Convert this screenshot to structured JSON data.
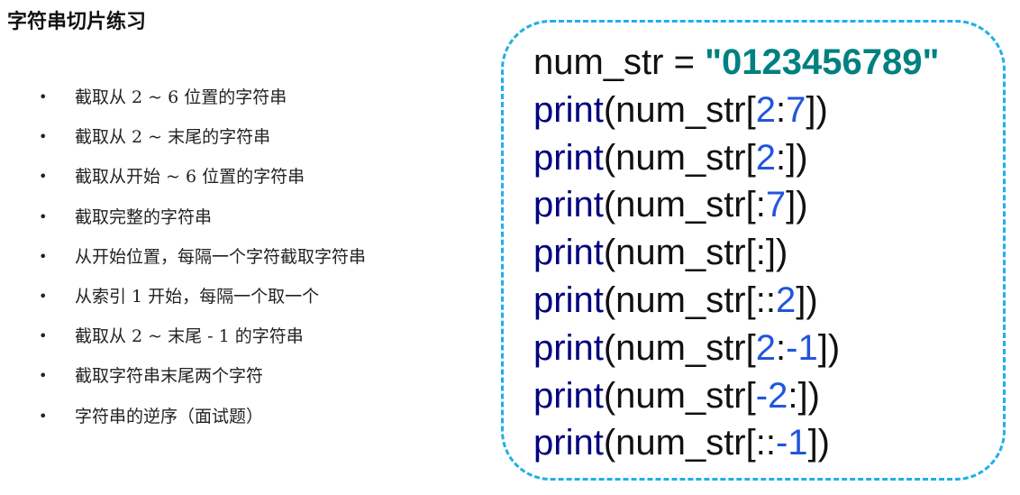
{
  "title": "字符串切片练习",
  "tasks": [
    "截取从 2 ~ 6 位置的字符串",
    "截取从 2 ~ 末尾的字符串",
    "截取从开始 ~ 6 位置的字符串",
    "截取完整的字符串",
    "从开始位置，每隔一个字符截取字符串",
    "从索引 1 开始，每隔一个取一个",
    "截取从 2 ~ 末尾 - 1 的字符串",
    "截取字符串末尾两个字符",
    "字符串的逆序（面试题）"
  ],
  "code": {
    "assign": {
      "var": "num_str = ",
      "value": "\"0123456789\""
    },
    "lines": [
      {
        "fn": "print",
        "pre": "(num_str[",
        "a": "2",
        "sep": ":",
        "b": "7",
        "post": "])"
      },
      {
        "fn": "print",
        "pre": "(num_str[",
        "a": "2",
        "sep": ":",
        "b": "",
        "post": "])"
      },
      {
        "fn": "print",
        "pre": "(num_str[",
        "a": "",
        "sep": ":",
        "b": "7",
        "post": "])"
      },
      {
        "fn": "print",
        "pre": "(num_str[",
        "a": "",
        "sep": ":",
        "b": "",
        "post": "])"
      },
      {
        "fn": "print",
        "pre": "(num_str[",
        "a": "",
        "sep": "::",
        "b": "2",
        "post": "])"
      },
      {
        "fn": "print",
        "pre": "(num_str[",
        "a": "2",
        "sep": ":",
        "b": "-1",
        "post": "])"
      },
      {
        "fn": "print",
        "pre": "(num_str[",
        "a": "-2",
        "sep": ":",
        "b": "",
        "post": "])"
      },
      {
        "fn": "print",
        "pre": "(num_str[",
        "a": "",
        "sep": "::",
        "b": "-1",
        "post": "])"
      }
    ]
  },
  "colors": {
    "keyword": "#000080",
    "number": "#2255dd",
    "string": "#008080",
    "border": "#1fb0e6"
  }
}
